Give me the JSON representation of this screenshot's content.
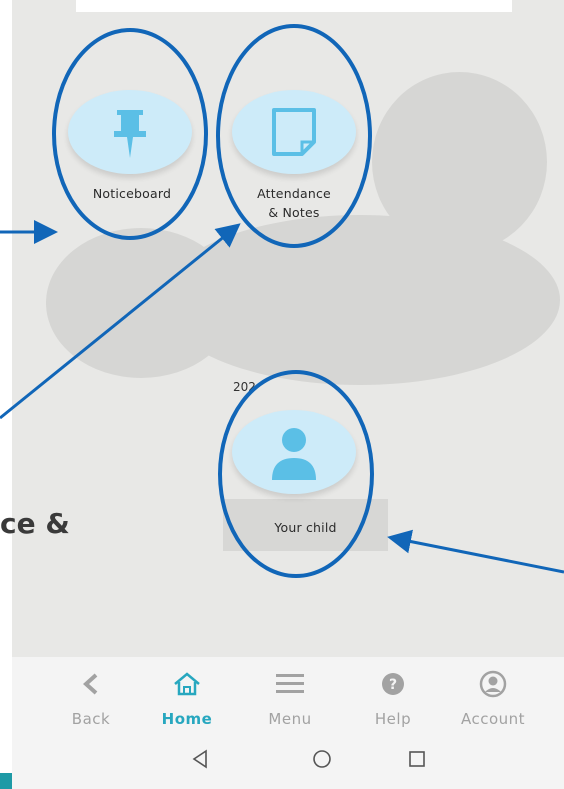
{
  "tiles": {
    "noticeboard": {
      "label": "Noticeboard",
      "icon": "pushpin-icon"
    },
    "attendance": {
      "label_line1": "Attendance",
      "label_line2": "& Notes",
      "icon": "note-icon"
    },
    "your_child": {
      "label": "Your child",
      "icon": "person-icon"
    }
  },
  "partial_text": "202",
  "side_text": "ce &",
  "bottom_nav": {
    "items": [
      {
        "label": "Back",
        "icon": "chevron-left-icon"
      },
      {
        "label": "Home",
        "icon": "home-icon"
      },
      {
        "label": "Menu",
        "icon": "hamburger-icon"
      },
      {
        "label": "Help",
        "icon": "help-icon"
      },
      {
        "label": "Account",
        "icon": "account-icon"
      }
    ],
    "active": "Home"
  },
  "system_bar": {
    "buttons": [
      "back-triangle-icon",
      "home-circle-icon",
      "recents-square-icon"
    ]
  },
  "colors": {
    "accent": "#27a7bf",
    "tile_bg": "#cdebf9",
    "icon_blue": "#5bbfe6",
    "annotation": "#1166b8"
  }
}
